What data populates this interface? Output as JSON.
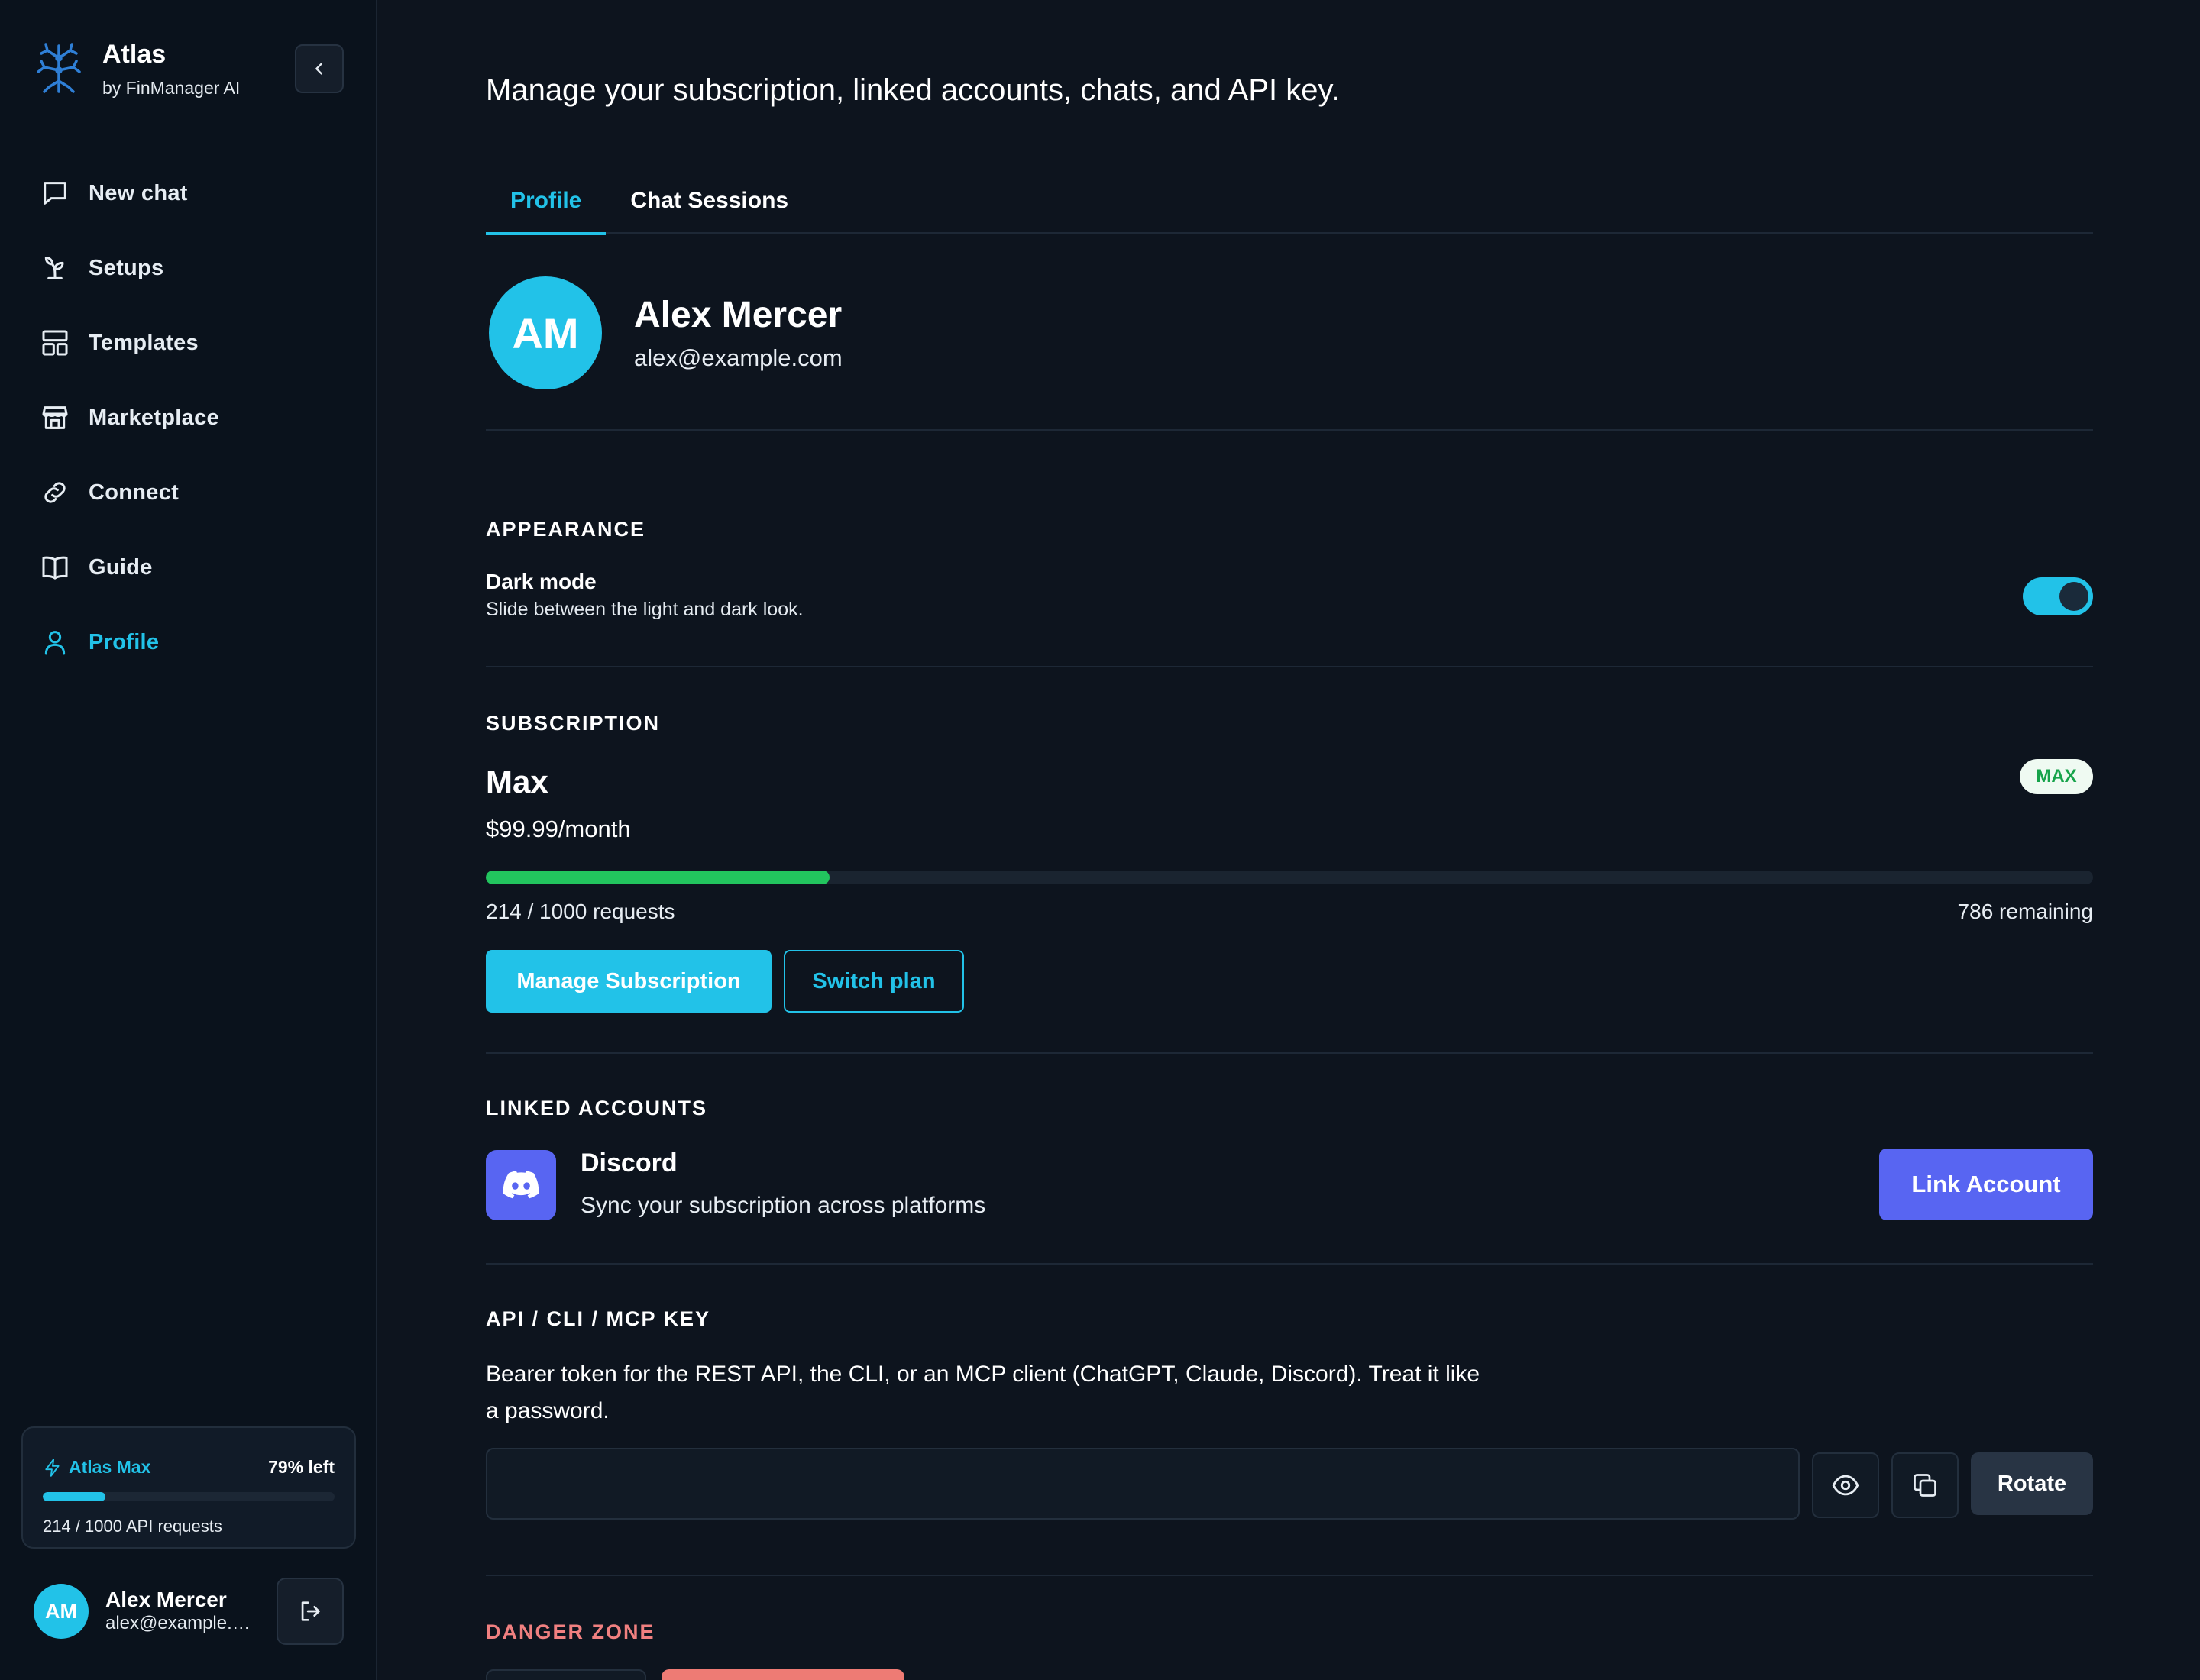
{
  "app": {
    "name": "Atlas",
    "byline": "by FinManager AI"
  },
  "sidebar": {
    "items": [
      {
        "label": "New chat",
        "icon": "chat-bubble-icon"
      },
      {
        "label": "Setups",
        "icon": "sprout-icon"
      },
      {
        "label": "Templates",
        "icon": "layout-icon"
      },
      {
        "label": "Marketplace",
        "icon": "store-icon"
      },
      {
        "label": "Connect",
        "icon": "link-icon"
      },
      {
        "label": "Guide",
        "icon": "book-icon"
      },
      {
        "label": "Profile",
        "icon": "user-icon",
        "active": true
      }
    ],
    "usage": {
      "plan": "Atlas Max",
      "left": "79% left",
      "used": 214,
      "limit": 1000,
      "text": "214 / 1000 API requests"
    },
    "user": {
      "initials": "AM",
      "name": "Alex Mercer",
      "email": "alex@example.com"
    }
  },
  "header": {
    "subtitle": "Manage your subscription, linked accounts, chats, and API key."
  },
  "tabs": [
    {
      "label": "Profile",
      "active": true
    },
    {
      "label": "Chat Sessions",
      "active": false
    }
  ],
  "profile": {
    "initials": "AM",
    "name": "Alex Mercer",
    "email": "alex@example.com"
  },
  "appearance": {
    "title": "APPEARANCE",
    "dark_mode_label": "Dark mode",
    "dark_mode_desc": "Slide between the light and dark look.",
    "dark_mode_on": true
  },
  "subscription": {
    "title": "SUBSCRIPTION",
    "plan": "Max",
    "badge": "MAX",
    "price": "$99.99/month",
    "used": 214,
    "limit": 1000,
    "used_text": "214 / 1000 requests",
    "remaining_text": "786 remaining",
    "manage_label": "Manage Subscription",
    "switch_label": "Switch plan"
  },
  "linked_accounts": {
    "title": "LINKED ACCOUNTS",
    "service": "Discord",
    "desc": "Sync your subscription across platforms",
    "button": "Link Account"
  },
  "api": {
    "title": "API / CLI / MCP KEY",
    "desc": "Bearer token for the REST API, the CLI, or an MCP client (ChatGPT, Claude, Discord). Treat it like a password.",
    "key_value": "",
    "rotate_label": "Rotate"
  },
  "danger": {
    "title": "DANGER ZONE"
  },
  "colors": {
    "accent": "#22c2e8",
    "discord": "#5865f2",
    "success": "#22c55e",
    "danger": "#f08080",
    "background": "#0d141e"
  }
}
